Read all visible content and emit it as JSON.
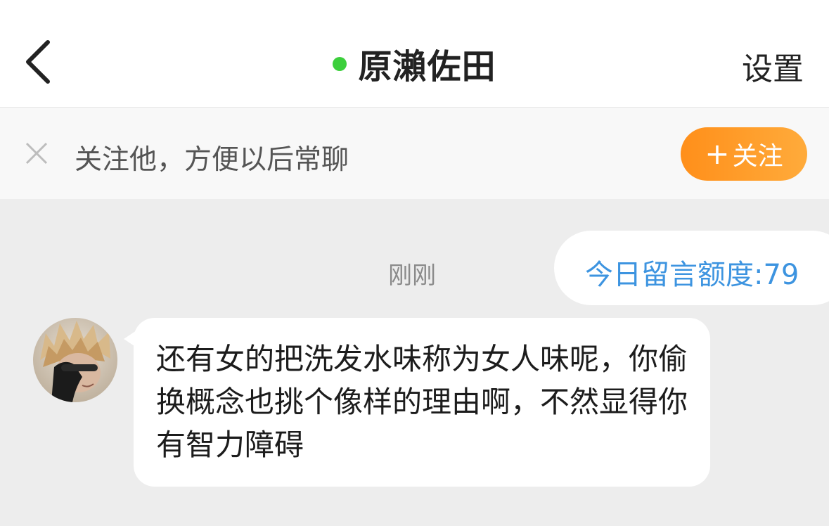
{
  "header": {
    "title": "原瀨佐田",
    "settings_label": "设置",
    "online_color": "#3ccf3c",
    "back_icon": "chevron-left-icon"
  },
  "follow_bar": {
    "prompt": "关注他，方便以后常聊",
    "close_icon": "close-icon",
    "button_label": "关注",
    "button_plus": "+",
    "button_color": "#ff9a26"
  },
  "chat": {
    "timestamp": "刚刚",
    "quota_text": "今日留言额度:79",
    "quota_color": "#3d94e0",
    "messages": [
      {
        "text": "还有女的把洗发水味称为女人味呢，你偷换概念也挑个像样的理由啊，不然显得你有智力障碍"
      }
    ]
  }
}
